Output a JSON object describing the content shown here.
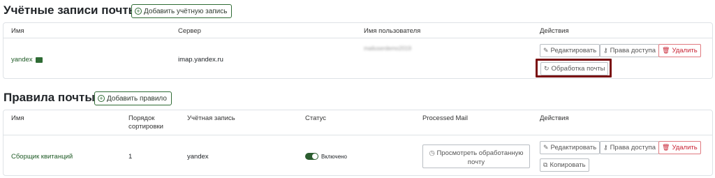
{
  "accounts_section": {
    "title": "Учётные записи почты",
    "add_button": "Добавить учётную запись",
    "headers": [
      "Имя",
      "Сервер",
      "Имя пользователя",
      "Действия"
    ],
    "row": {
      "name": "yandex",
      "server": "imap.yandex.ru",
      "username": "mailuserdemo2019"
    },
    "actions": {
      "edit": "Редактировать",
      "access": "Права доступа",
      "delete": "Удалить",
      "process": "Обработка почты"
    }
  },
  "rules_section": {
    "title": "Правила почты",
    "add_button": "Добавить правило",
    "headers": [
      "Имя",
      "Порядок сортировки",
      "Учётная запись",
      "Статус",
      "Processed Mail",
      "Действия"
    ],
    "row": {
      "name": "Сборщик квитанций",
      "order": "1",
      "account": "yandex",
      "status": "Включено",
      "processed_button": "Просмотреть обработанную почту"
    },
    "actions": {
      "edit": "Редактировать",
      "access": "Права доступа",
      "delete": "Удалить",
      "copy": "Копировать"
    }
  },
  "colors": {
    "accent": "#2e6b34",
    "danger": "#c82333",
    "highlight": "#7a0d10"
  },
  "icons": {
    "add": "plus-circle-icon",
    "mail": "envelope-icon",
    "edit": "pencil-icon",
    "access": "user-key-icon",
    "delete": "trash-icon",
    "process": "refresh-icon",
    "processed": "clock-icon",
    "copy": "copy-icon"
  }
}
